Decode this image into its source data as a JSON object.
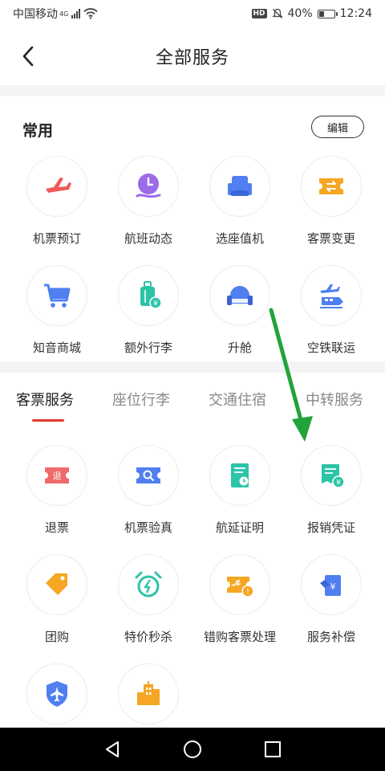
{
  "status_bar": {
    "carrier": "中国移动",
    "network": "4G",
    "hd": "HD",
    "battery": "40%",
    "battery_level": 0.4,
    "time": "12:24"
  },
  "header": {
    "title": "全部服务"
  },
  "common": {
    "title": "常用",
    "edit_label": "编辑",
    "items": [
      {
        "label": "机票预订",
        "icon": "airplane-icon"
      },
      {
        "label": "航班动态",
        "icon": "clock-hand-icon"
      },
      {
        "label": "选座值机",
        "icon": "seat-icon"
      },
      {
        "label": "客票变更",
        "icon": "ticket-exchange-icon"
      },
      {
        "label": "知音商城",
        "icon": "shopping-cart-icon"
      },
      {
        "label": "额外行李",
        "icon": "luggage-icon"
      },
      {
        "label": "升舱",
        "icon": "armchair-icon"
      },
      {
        "label": "空铁联运",
        "icon": "plane-train-icon"
      }
    ]
  },
  "tabs": [
    {
      "label": "客票服务",
      "active": true
    },
    {
      "label": "座位行李",
      "active": false
    },
    {
      "label": "交通住宿",
      "active": false
    },
    {
      "label": "中转服务",
      "active": false
    }
  ],
  "services": {
    "items": [
      {
        "label": "退票",
        "icon": "refund-ticket-icon"
      },
      {
        "label": "机票验真",
        "icon": "ticket-verify-icon"
      },
      {
        "label": "航延证明",
        "icon": "delay-certificate-icon"
      },
      {
        "label": "报销凭证",
        "icon": "receipt-icon"
      },
      {
        "label": "团购",
        "icon": "tag-icon"
      },
      {
        "label": "特价秒杀",
        "icon": "alarm-clock-icon"
      },
      {
        "label": "错购客票处理",
        "icon": "ticket-error-icon"
      },
      {
        "label": "服务补偿",
        "icon": "compensation-icon"
      },
      {
        "label": "",
        "icon": "shield-plane-icon"
      },
      {
        "label": "",
        "icon": "city-building-icon"
      }
    ]
  },
  "colors": {
    "accent_red": "#e23a2e",
    "arrow_green": "#22a33a"
  }
}
